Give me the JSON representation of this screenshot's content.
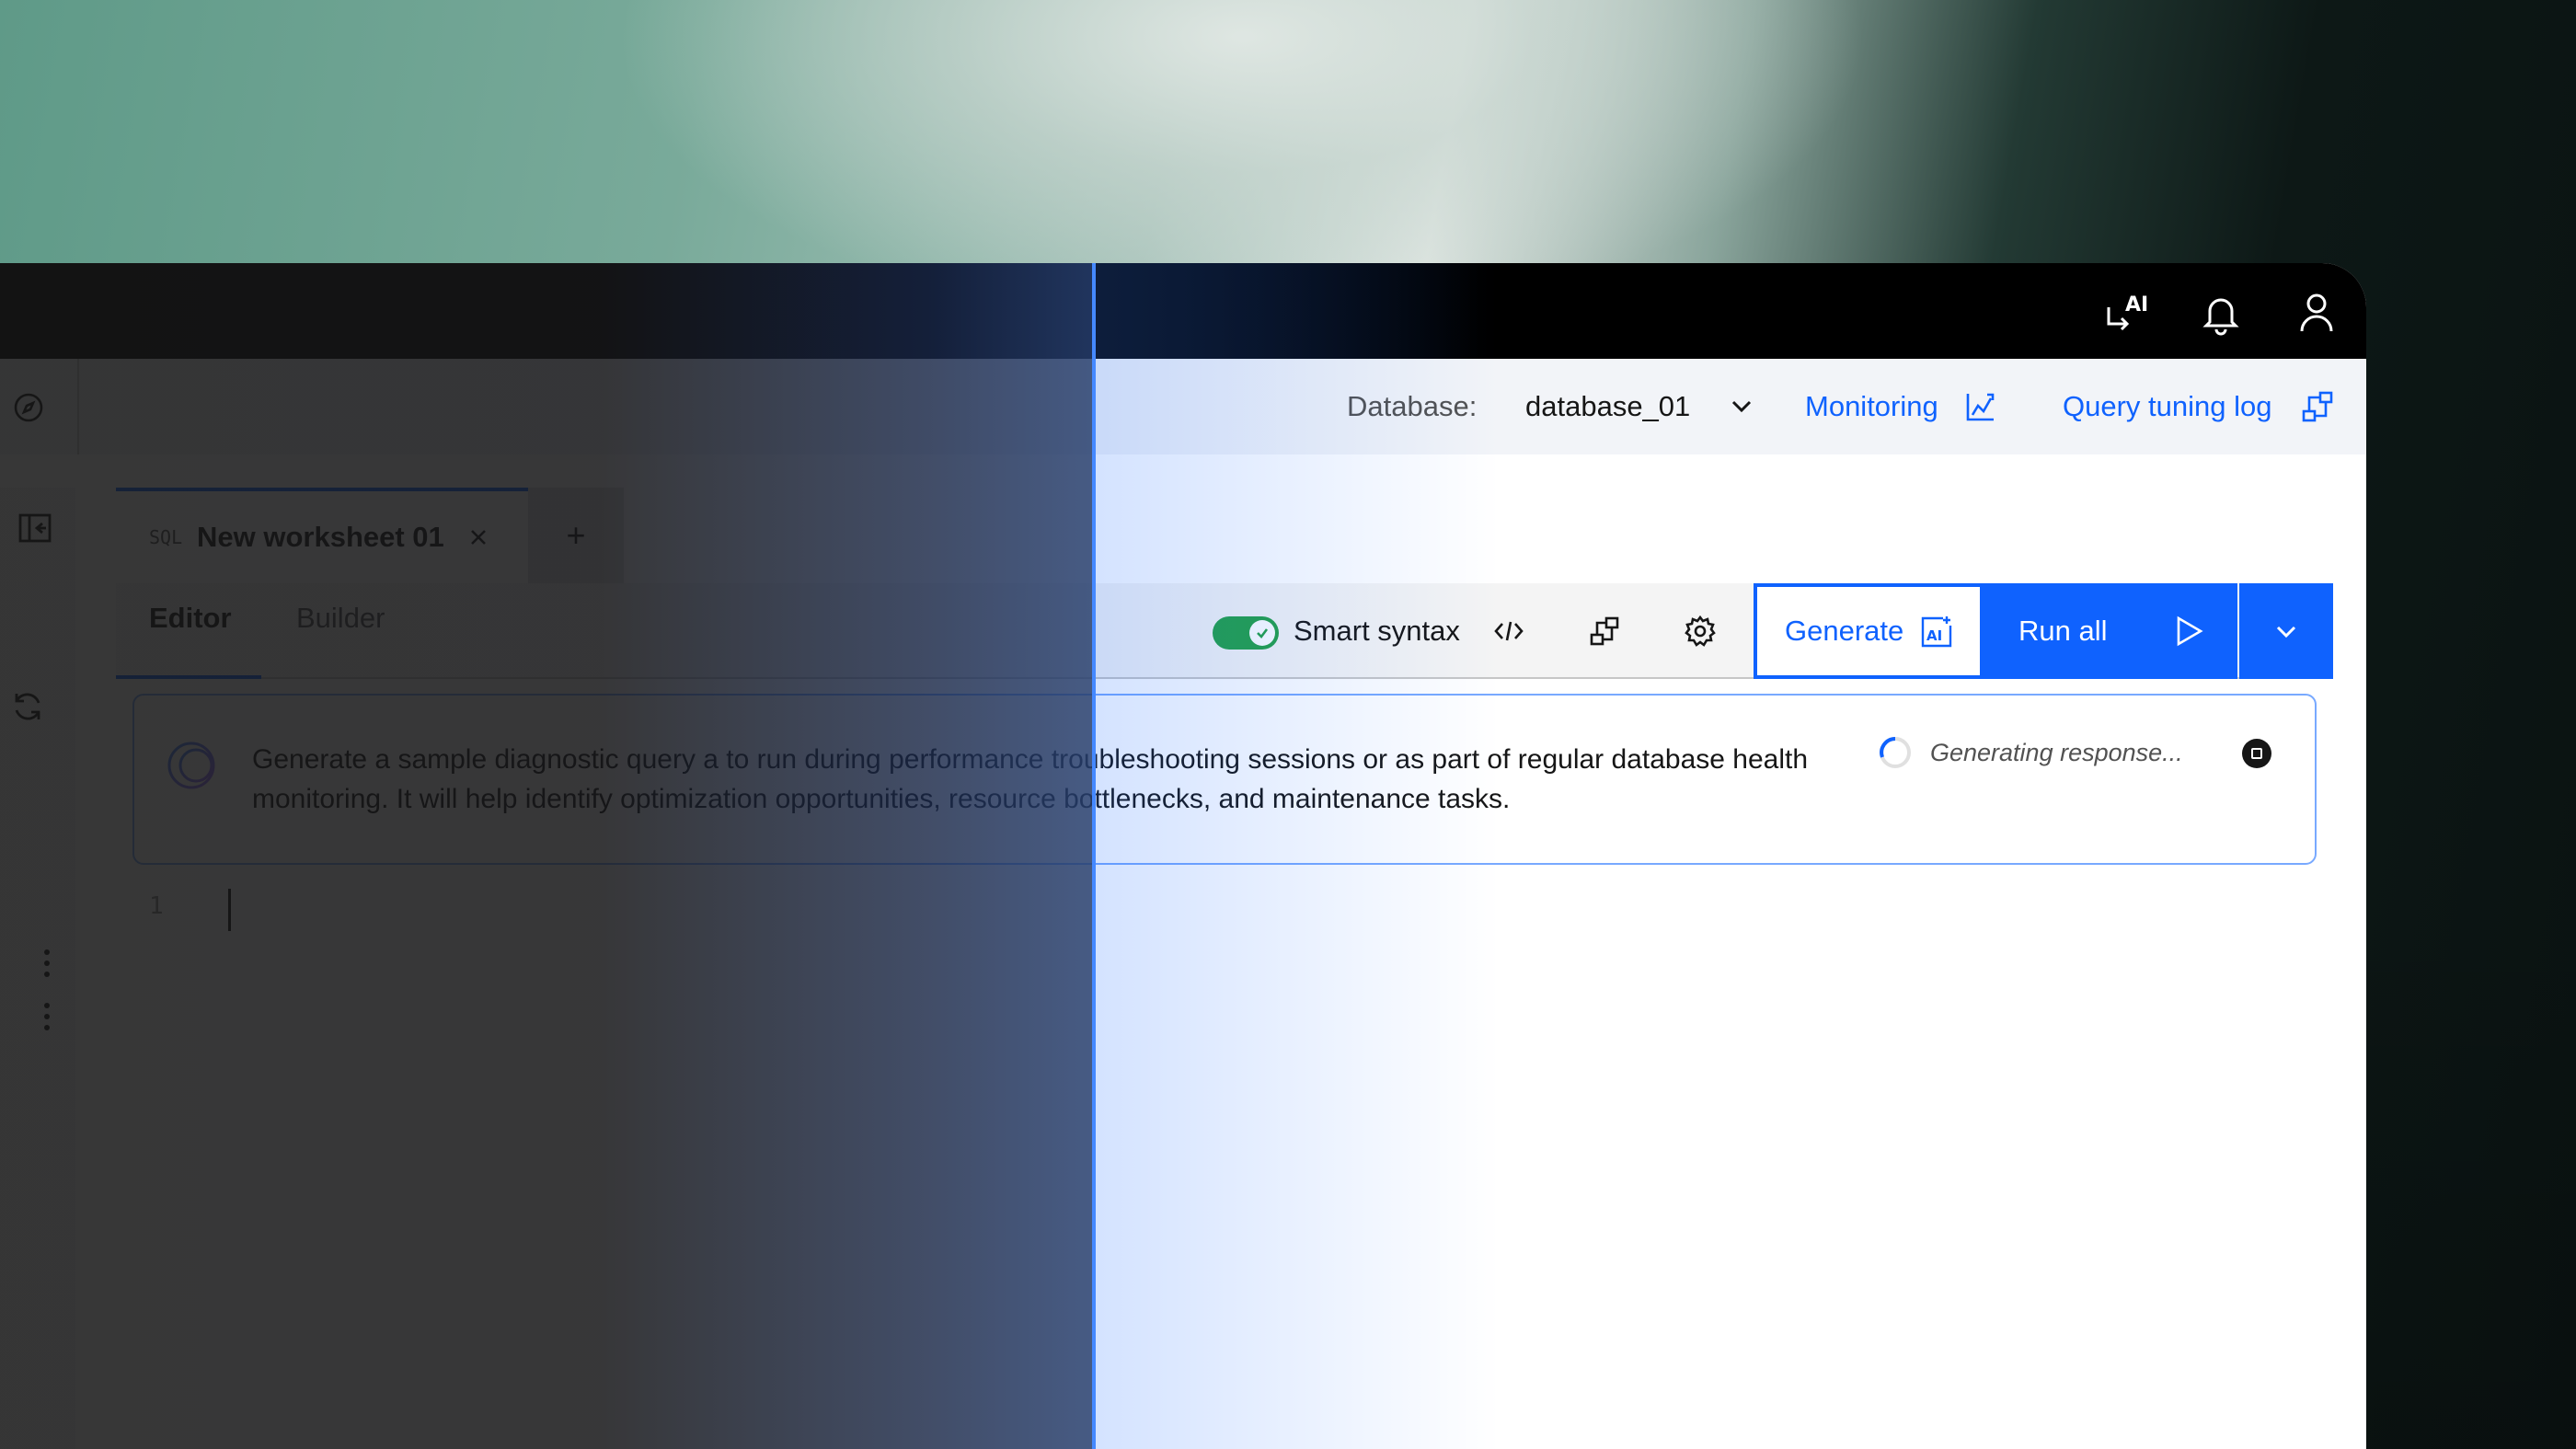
{
  "header": {
    "icons": [
      "ai-assistant-icon",
      "notification-icon",
      "user-icon"
    ]
  },
  "subbar": {
    "database_label": "Database:",
    "database_value": "database_01",
    "monitoring_label": "Monitoring",
    "query_tuning_label": "Query tuning log"
  },
  "worksheet": {
    "tab_prefix": "SQL",
    "tab_name": "New worksheet 01",
    "add_tab": "+",
    "subtabs": [
      "Editor",
      "Builder"
    ]
  },
  "toolbar": {
    "smart_syntax_label": "Smart syntax",
    "smart_syntax_on": true,
    "generate_label": "Generate",
    "run_all_label": "Run all"
  },
  "prompt": {
    "text": "Generate a sample diagnostic query a to run during performance troubleshooting sessions or as part of regular database health monitoring. It will help identify optimization opportunities, resource bottlenecks, and maintenance tasks.",
    "status": "Generating response..."
  },
  "editor": {
    "line_numbers": [
      "1"
    ]
  },
  "colors": {
    "accent": "#0f62fe",
    "toggle_on": "#24a148",
    "divider": "#4589ff"
  }
}
